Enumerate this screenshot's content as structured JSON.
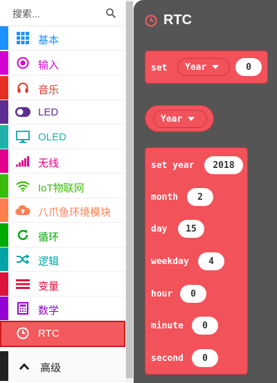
{
  "search": {
    "placeholder": "搜索..."
  },
  "categories": [
    {
      "label": "基本",
      "color": "#1e90ff",
      "icon": "grid-icon"
    },
    {
      "label": "输入",
      "color": "#d400d4",
      "icon": "radio-target-icon"
    },
    {
      "label": "音乐",
      "color": "#e63022",
      "icon": "headphones-icon"
    },
    {
      "label": "LED",
      "color": "#5c2d91",
      "icon": "toggle-icon"
    },
    {
      "label": "OLED",
      "color": "#20b2aa",
      "icon": "monitor-icon"
    },
    {
      "label": "无线",
      "color": "#e3008c",
      "icon": "signal-bars-icon"
    },
    {
      "label": "IoT物联网",
      "color": "#3cbc0a",
      "icon": "wifi-icon"
    },
    {
      "label": "八爪鱼环境模块",
      "color": "#ff7f50",
      "icon": "cloud-upload-icon"
    },
    {
      "label": "循环",
      "color": "#00aa00",
      "icon": "refresh-icon"
    },
    {
      "label": "逻辑",
      "color": "#00a4a6",
      "icon": "shuffle-icon"
    },
    {
      "label": "变量",
      "color": "#dc143c",
      "icon": "lines-icon"
    },
    {
      "label": "数学",
      "color": "#9400d3",
      "icon": "calculator-icon"
    },
    {
      "label": "RTC",
      "color": "#f25a5e",
      "icon": "clock-icon",
      "selected": true
    },
    {
      "label": "高级",
      "color": "#222222",
      "icon": "chevron-up-icon"
    }
  ],
  "flyout": {
    "title": "RTC",
    "set_block": {
      "label": "set",
      "field": "Year",
      "value": "0"
    },
    "year_reporter": {
      "field": "Year"
    },
    "big_block": {
      "rows": [
        {
          "label": "set year",
          "value": "2018"
        },
        {
          "label": "month",
          "value": "2"
        },
        {
          "label": "day",
          "value": "15"
        },
        {
          "label": "weekday",
          "value": "4"
        },
        {
          "label": "hour",
          "value": "0"
        },
        {
          "label": "minute",
          "value": "0"
        },
        {
          "label": "second",
          "value": "0"
        }
      ]
    }
  }
}
